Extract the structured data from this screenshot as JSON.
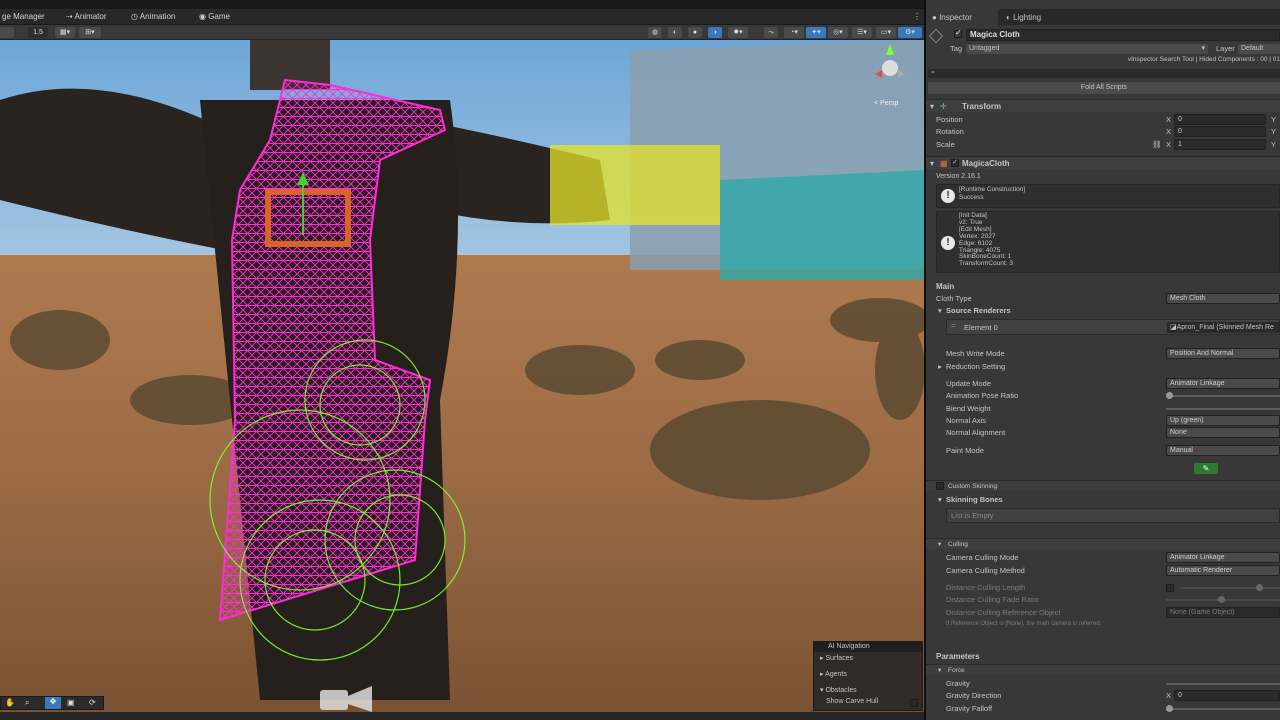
{
  "tabs": {
    "stage_manager": "ge Manager",
    "animator": "Animator",
    "animation": "Animation",
    "game": "Game",
    "more": "⋮"
  },
  "scene_toolbar": {
    "zoom_value": "1.5"
  },
  "viewport": {
    "gizmo_label": "< Persp"
  },
  "ai_navigation": {
    "title": "AI Navigation",
    "surfaces": "Surfaces",
    "agents": "Agents",
    "obstacles": "Obstacles",
    "show_carve_hull": "Show Carve Hull"
  },
  "inspector": {
    "tab_inspector": "Inspector",
    "tab_lighting": "Lighting",
    "object_name": "Magica Cloth",
    "tag_label": "Tag",
    "tag_value": "Untagged",
    "layer_label": "Layer",
    "layer_value": "Default",
    "vinspector_text": "vInspector Search Tool | Hided Components : 00 | 01",
    "fold_all": "Fold All Scripts",
    "transform": {
      "title": "Transform",
      "position": "Position",
      "rotation": "Rotation",
      "scale": "Scale",
      "x": "X",
      "y": "Y",
      "pos_x": "0",
      "rot_x": "0",
      "scale_x": "1"
    },
    "magica": {
      "title": "MagicaCloth",
      "version": "Version 2.16.1",
      "runtime_line1": "[Runtime Construction]",
      "runtime_line2": "Success",
      "info_lines": [
        "[Init Data]",
        "v2: True",
        "[Edit Mesh]",
        "Vertex: 2027",
        "Edge: 6102",
        "Triangle: 4075",
        "SkinBoneCount: 1",
        "TransformCount: 3"
      ],
      "main": "Main",
      "cloth_type_label": "Cloth Type",
      "cloth_type_value": "Mesh Cloth",
      "source_renderers": "Source Renderers",
      "element0": "Element 0",
      "element0_value": "Apron_Final (Skinned Mesh Re",
      "mesh_write_mode": "Mesh Write Mode",
      "mesh_write_mode_value": "Position And Normal",
      "reduction_setting": "Reduction Setting",
      "update_mode": "Update Mode",
      "update_mode_value": "Animator Linkage",
      "anim_pose_ratio": "Animation Pose Ratio",
      "blend_weight": "Blend Weight",
      "normal_axis": "Normal Axis",
      "normal_axis_value": "Up (green)",
      "normal_alignment": "Normal Alignment",
      "normal_alignment_value": "None",
      "paint_mode": "Paint Mode",
      "paint_mode_value": "Manual",
      "custom_skinning": "Custom Skinning",
      "skinning_bones": "Skinning Bones",
      "list_empty": "List is Empty",
      "culling": "Culling",
      "camera_culling_mode": "Camera Culling Mode",
      "camera_culling_mode_value": "Animator Linkage",
      "camera_culling_method": "Camera Culling Method",
      "camera_culling_method_value": "Automatic Renderer",
      "distance_culling_length": "Distance Culling Length",
      "distance_culling_fade": "Distance Culling Fade Ratio",
      "distance_culling_ref": "Distance Culling Reference Object",
      "distance_culling_ref_value": "None (Game Object)",
      "ref_note": "If Reference Object is [None], the main camera is referred.",
      "parameters": "Parameters",
      "force": "Force",
      "gravity": "Gravity",
      "gravity_direction": "Gravity Direction",
      "gravity_dir_x": "0",
      "gravity_falloff": "Gravity Falloff"
    }
  },
  "colors": {
    "accent_blue": "#3a79bb",
    "mesh_magenta": "#ff2bd6",
    "collider_green": "#7dff2a",
    "paint_green": "#2f7a2f"
  }
}
